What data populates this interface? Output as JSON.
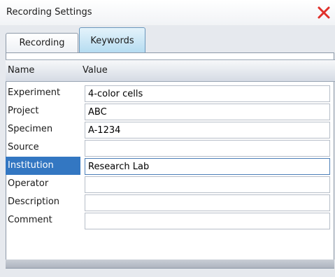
{
  "window": {
    "title": "Recording Settings",
    "close_icon": "close-x-icon",
    "close_color": "#e0302a"
  },
  "tabs": [
    {
      "label": "Recording",
      "selected": false
    },
    {
      "label": "Keywords",
      "selected": true
    }
  ],
  "grid": {
    "columns": [
      "Name",
      "Value"
    ],
    "rows": [
      {
        "name": "Experiment",
        "value": "4-color cells"
      },
      {
        "name": "Project",
        "value": "ABC"
      },
      {
        "name": "Specimen",
        "value": "A-1234"
      },
      {
        "name": "Source",
        "value": ""
      },
      {
        "name": "Institution",
        "value": "Research Lab"
      },
      {
        "name": "Operator",
        "value": ""
      },
      {
        "name": "Description",
        "value": ""
      },
      {
        "name": "Comment",
        "value": ""
      }
    ],
    "selected_row": "Institution",
    "selection_color": "#3377c2"
  }
}
